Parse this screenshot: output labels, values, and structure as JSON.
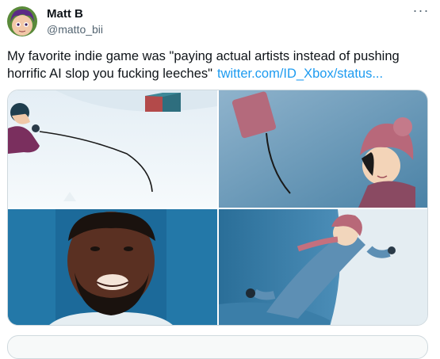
{
  "tweet": {
    "display_name": "Matt B",
    "handle": "@matto_bii",
    "text": "My favorite indie game was \"paying actual artists instead of pushing horrific AI slop you fucking leeches\"",
    "link_text": "twitter.com/ID_Xbox/status...",
    "more_icon": "···"
  },
  "media": {
    "images": [
      {
        "name": "snow-scene-microphone-image"
      },
      {
        "name": "girl-pink-hat-image"
      },
      {
        "name": "man-beard-portrait-image"
      },
      {
        "name": "child-sliding-snow-image"
      }
    ]
  },
  "colors": {
    "link": "#1d9bf0",
    "secondary_text": "#536471",
    "border": "#cfd9de"
  }
}
